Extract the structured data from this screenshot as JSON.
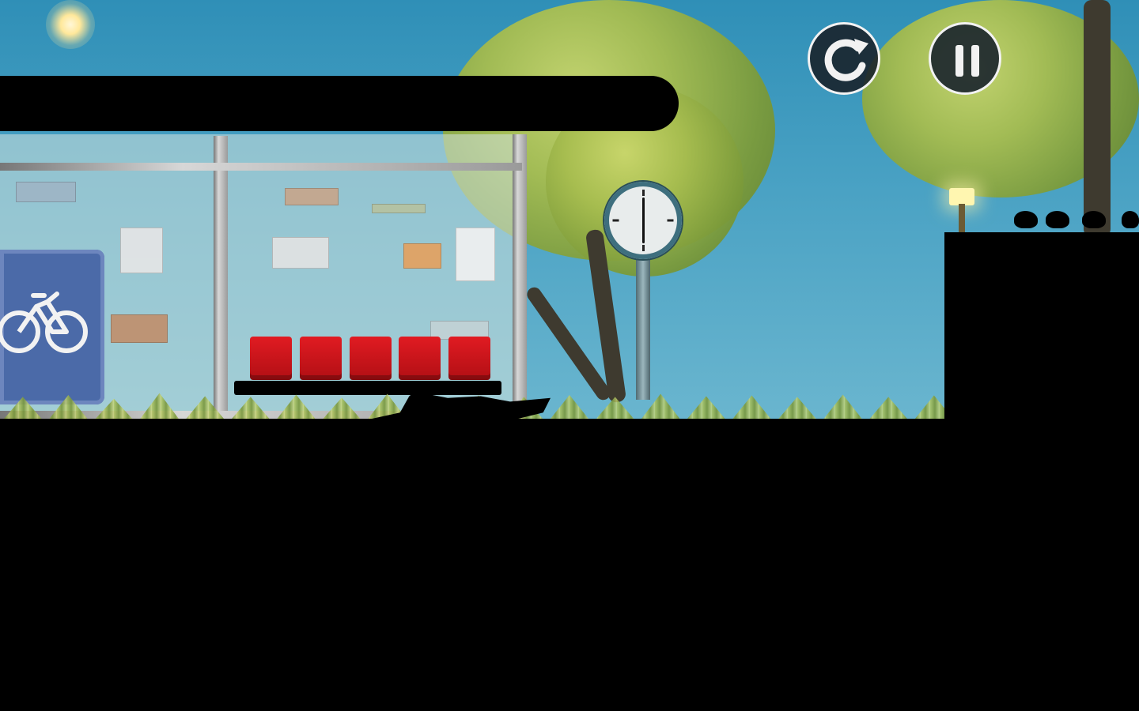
{
  "scene": {
    "description_hidden": false
  },
  "hud": {
    "buttons": [
      {
        "name": "restart-button",
        "icon": "restart-icon"
      },
      {
        "name": "pause-button",
        "icon": "pause-icon"
      }
    ]
  },
  "colors": {
    "sky_top": "#2f8fb7",
    "sky_bottom": "#6bb6cf",
    "seat_red": "#e11b22",
    "button_bg": "#19242c",
    "button_ring": "#f2f2f2",
    "sign_blue": "#4b6aa8"
  },
  "icons": {
    "restart": "circular-arrow",
    "pause": "double-bar",
    "bike": "bicycle",
    "clock": "analog-clock"
  }
}
